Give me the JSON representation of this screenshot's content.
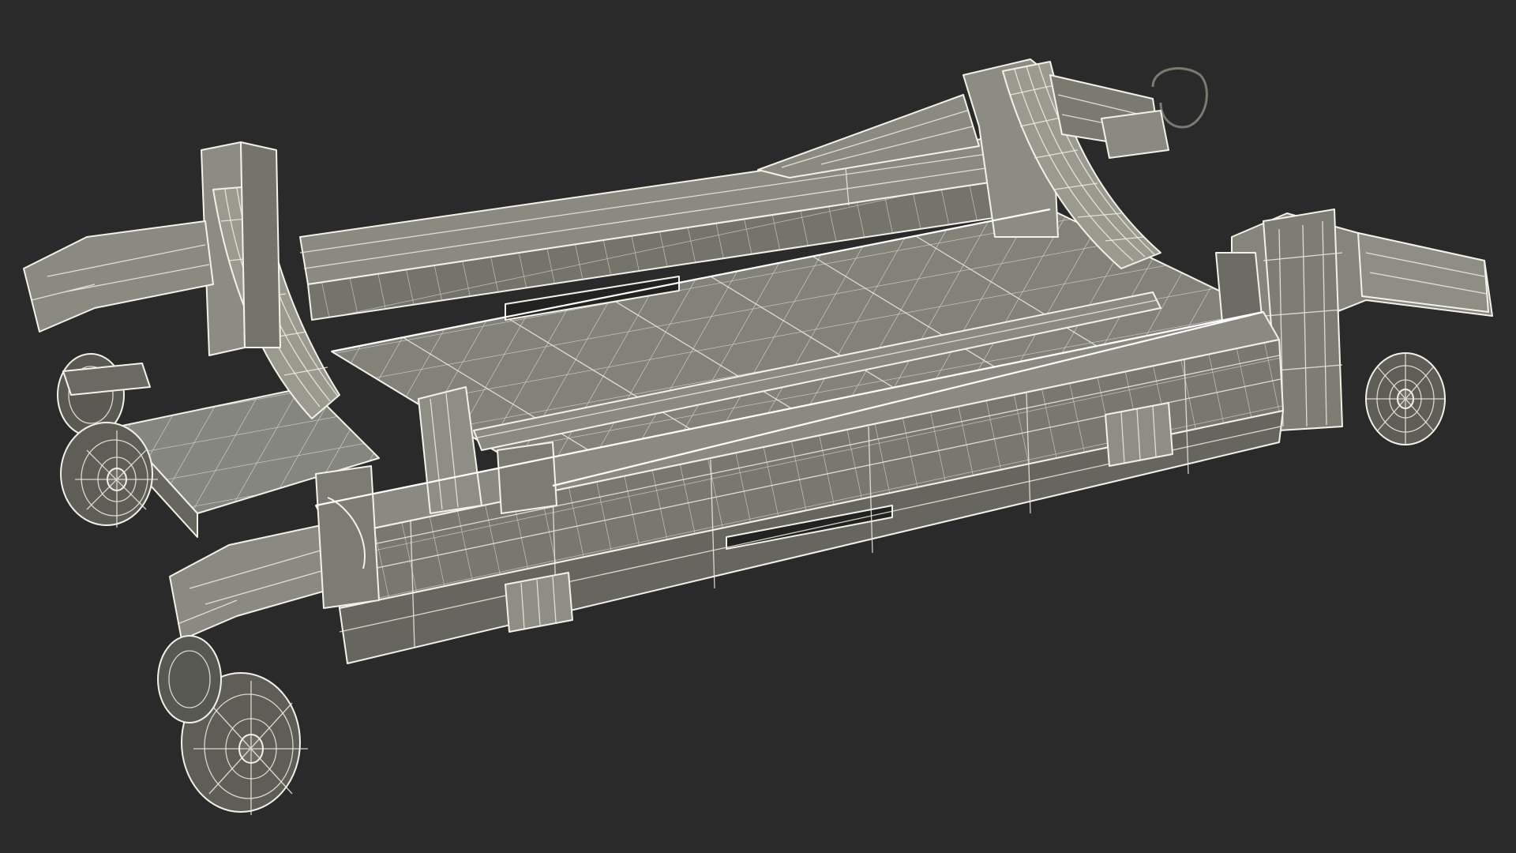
{
  "scene": {
    "subject": "wireframe-cart-render",
    "colors": {
      "background": "#2a2a2a",
      "body_light": "#8a8a80",
      "body_mid": "#74746b",
      "body_dark": "#5c5c55",
      "body_shadow": "#4a4a44",
      "wire": "#eeeee2"
    }
  }
}
